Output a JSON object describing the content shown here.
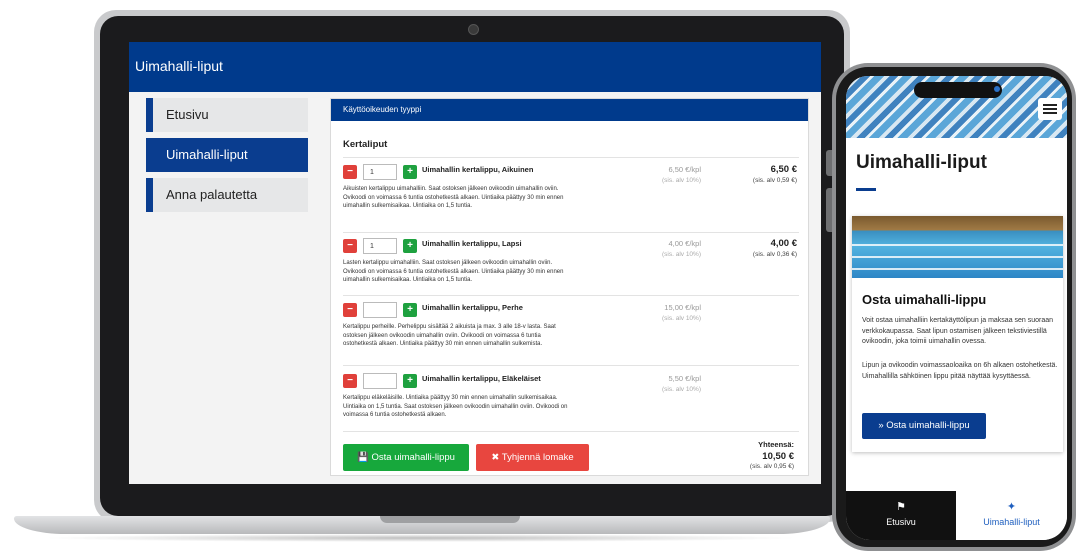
{
  "desktop": {
    "header_title": "Uimahalli-liput",
    "nav": [
      {
        "label": "Etusivu"
      },
      {
        "label": "Uimahalli-liput"
      },
      {
        "label": "Anna palautetta"
      }
    ],
    "panel_title": "Käyttöoikeuden tyyppi",
    "section_title": "Kertaliput",
    "products": [
      {
        "name": "Uimahallin kertalippu, Aikuinen",
        "qty": "1",
        "desc": "Aikuisten kertalippu uimahalliin. Saat ostoksen jälkeen ovikoodin uimahallin oviin. Ovikoodi on voimassa 6 tuntia ostohetkestä alkaen. Uintiaika päättyy 30 min ennen uimahallin sulkemisaikaa. Uintiaika on 1,5 tuntia.",
        "unit_price": "6,50 €/kpl",
        "unit_vat": "(sis. alv 10%)",
        "line_price": "6,50 €",
        "line_vat": "(sis. alv 0,59 €)"
      },
      {
        "name": "Uimahallin kertalippu, Lapsi",
        "qty": "1",
        "desc": "Lasten kertalippu uimahalliin. Saat ostoksen jälkeen ovikoodin uimahallin oviin. Ovikoodi on voimassa 6 tuntia ostohetkestä alkaen. Uintiaika päättyy 30 min ennen uimahallin sulkemisaikaa. Uintiaika on 1,5 tuntia.",
        "unit_price": "4,00 €/kpl",
        "unit_vat": "(sis. alv 10%)",
        "line_price": "4,00 €",
        "line_vat": "(sis. alv 0,36 €)"
      },
      {
        "name": "Uimahallin kertalippu, Perhe",
        "qty": "",
        "desc": "Kertalippu perheille. Perhelippu sisältää 2 aikuista ja max. 3 alle 18-v lasta. Saat ostoksen jälkeen ovikoodin uimahallin oviin. Ovikoodi on voimassa 6 tuntia ostohetkestä alkaen. Uintiaika päättyy 30 min ennen uimahallin sulkemista.",
        "unit_price": "15,00 €/kpl",
        "unit_vat": "(sis. alv 10%)",
        "line_price": "",
        "line_vat": ""
      },
      {
        "name": "Uimahallin kertalippu, Eläkeläiset",
        "qty": "",
        "desc": "Kertalippu eläkeläisille. Uintiaika päättyy 30 min ennen uimahallin sulkemisaikaa. Uintiaika on 1,5 tuntia. Saat ostoksen jälkeen ovikoodin uimahallin oviin. Ovikoodi on voimassa 6 tuntia ostohetkestä alkaen.",
        "unit_price": "5,50 €/kpl",
        "unit_vat": "(sis. alv 10%)",
        "line_price": "",
        "line_vat": ""
      }
    ],
    "buy_label": "Osta uimahalli-lippu",
    "clear_label": "Tyhjennä lomake",
    "total_label": "Yhteensä:",
    "total_amount": "10,50 €",
    "total_vat": "(sis. alv 0,95 €)"
  },
  "mobile": {
    "title": "Uimahalli-liput",
    "card_title": "Osta uimahalli-lippu",
    "card_p1": "Voit ostaa uimahalliin kertakäyttölipun ja maksaa sen suoraan verkkokaupassa. Saat lipun ostamisen jälkeen tekstiviestillä ovikoodin, joka toimii uimahallin ovessa.",
    "card_p2": "Lipun ja ovikoodin voimassaoloaika on 6h alkaen ostohetkestä. Uimahallilla sähköinen lippu pitää näyttää kysyttäessä.",
    "card_button": "» Osta uimahalli-lippu",
    "tabs": [
      {
        "label": "Etusivu",
        "icon": "flag-icon"
      },
      {
        "label": "Uimahalli-liput",
        "icon": "ticket-icon"
      }
    ]
  },
  "colors": {
    "brand_blue": "#003a8c",
    "green": "#17a83c",
    "red": "#e8463f"
  }
}
